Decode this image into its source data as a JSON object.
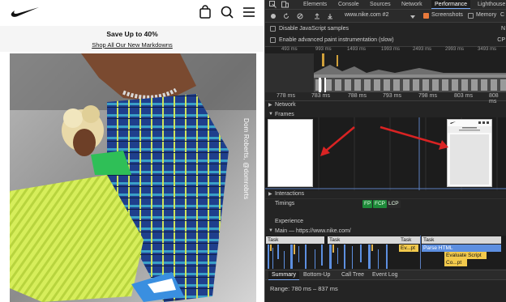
{
  "site": {
    "promo": {
      "headline": "Save Up to 40%",
      "link": "Shop All Our New Markdowns"
    },
    "hero_credit": "Dom Roberts, @domrobrts",
    "nav_icons": [
      "bag-icon",
      "search-icon",
      "menu-icon"
    ],
    "brand_color": "#111111"
  },
  "devtools": {
    "tabs": [
      "Elements",
      "Console",
      "Sources",
      "Network",
      "Performance",
      "Lighthouse"
    ],
    "active_tab": "Performance",
    "toolbar": {
      "url_select": "www.nike.com #2",
      "screenshots_label": "Screenshots",
      "memory_label": "Memory",
      "edge_label": "C"
    },
    "options": [
      {
        "label": "Disable JavaScript samples",
        "right": "N"
      },
      {
        "label": "Enable advanced paint instrumentation (slow)",
        "right": "CP"
      }
    ],
    "overview_ticks": [
      "493 ms",
      "993 ms",
      "1493 ms",
      "1993 ms",
      "2493 ms",
      "2993 ms",
      "3493 ms"
    ],
    "ruler_ticks": [
      "778 ms",
      "783 ms",
      "788 ms",
      "793 ms",
      "798 ms",
      "803 ms",
      "808 ms"
    ],
    "tracks": {
      "network": "Network",
      "frames": "Frames",
      "interactions": "Interactions",
      "timings": "Timings",
      "experience": "Experience",
      "main": "Main — https://www.nike.com/"
    },
    "timing_badges": [
      {
        "label": "FP",
        "color": "#1e8a3a"
      },
      {
        "label": "FCP",
        "color": "#1e8a3a"
      },
      {
        "label": "LCP",
        "color": "#2a2a2a"
      }
    ],
    "main_tasks": {
      "task_label": "Task",
      "ev": "Ev...pt",
      "parse_html": "Parse HTML",
      "evaluate_script": "Evaluate Script",
      "co": "Co...pt"
    },
    "bottom_tabs": [
      "Summary",
      "Bottom-Up",
      "Call Tree",
      "Event Log"
    ],
    "active_bottom_tab": "Summary",
    "range": "Range: 780 ms – 837 ms",
    "colors": {
      "accent_orange": "#e8793b",
      "arrow_red": "#d92323",
      "task_yellow": "#f2c94c",
      "parse_blue": "#5d8fe0"
    }
  }
}
